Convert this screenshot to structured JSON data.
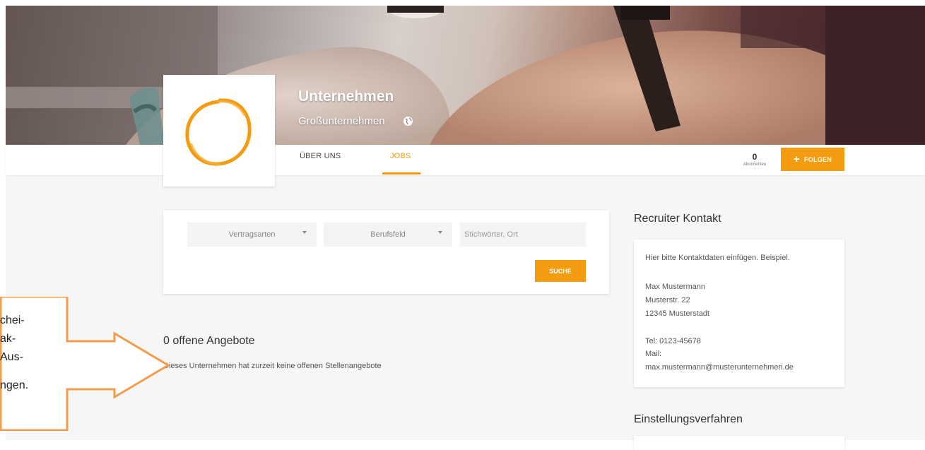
{
  "company": {
    "name": "Unternehmen",
    "type": "Großunternehmen"
  },
  "nav": {
    "tabs": [
      {
        "label": "ÜBER UNS",
        "active": false
      },
      {
        "label": "JOBS",
        "active": true
      }
    ],
    "followers_count": "0",
    "followers_label": "Abonnenten",
    "follow_label": "FOLGEN"
  },
  "search": {
    "contract_types": "Vertragsarten",
    "profession_field": "Berufsfeld",
    "keyword_placeholder": "Stichwörter, Ort",
    "button_label": "SUCHE"
  },
  "offers": {
    "heading": "0 offene Angebote",
    "empty_text": "Dieses Unternehmen hat zurzeit keine offenen Stellenangebote"
  },
  "recruiter": {
    "heading": "Recruiter Kontakt",
    "intro": "Hier bitte Kontaktdaten einfügen. Beispiel.",
    "name": "Max Mustermann",
    "street": "Musterstr. 22",
    "city": "12345 Musterstadt",
    "phone": "Tel: 0123-45678",
    "mail_label": "Mail:",
    "email": "max.mustermann@musterunternehmen.de"
  },
  "process": {
    "heading": "Einstellungsverfahren"
  },
  "annotation": {
    "lines": [
      "chei-",
      "ak-",
      "Aus-",
      "ngen."
    ]
  },
  "colors": {
    "accent": "#f39c12"
  },
  "icons": {
    "globe": "globe-icon",
    "plus": "plus-icon",
    "caret": "chevron-down-icon",
    "arrow": "arrow-right-icon"
  }
}
